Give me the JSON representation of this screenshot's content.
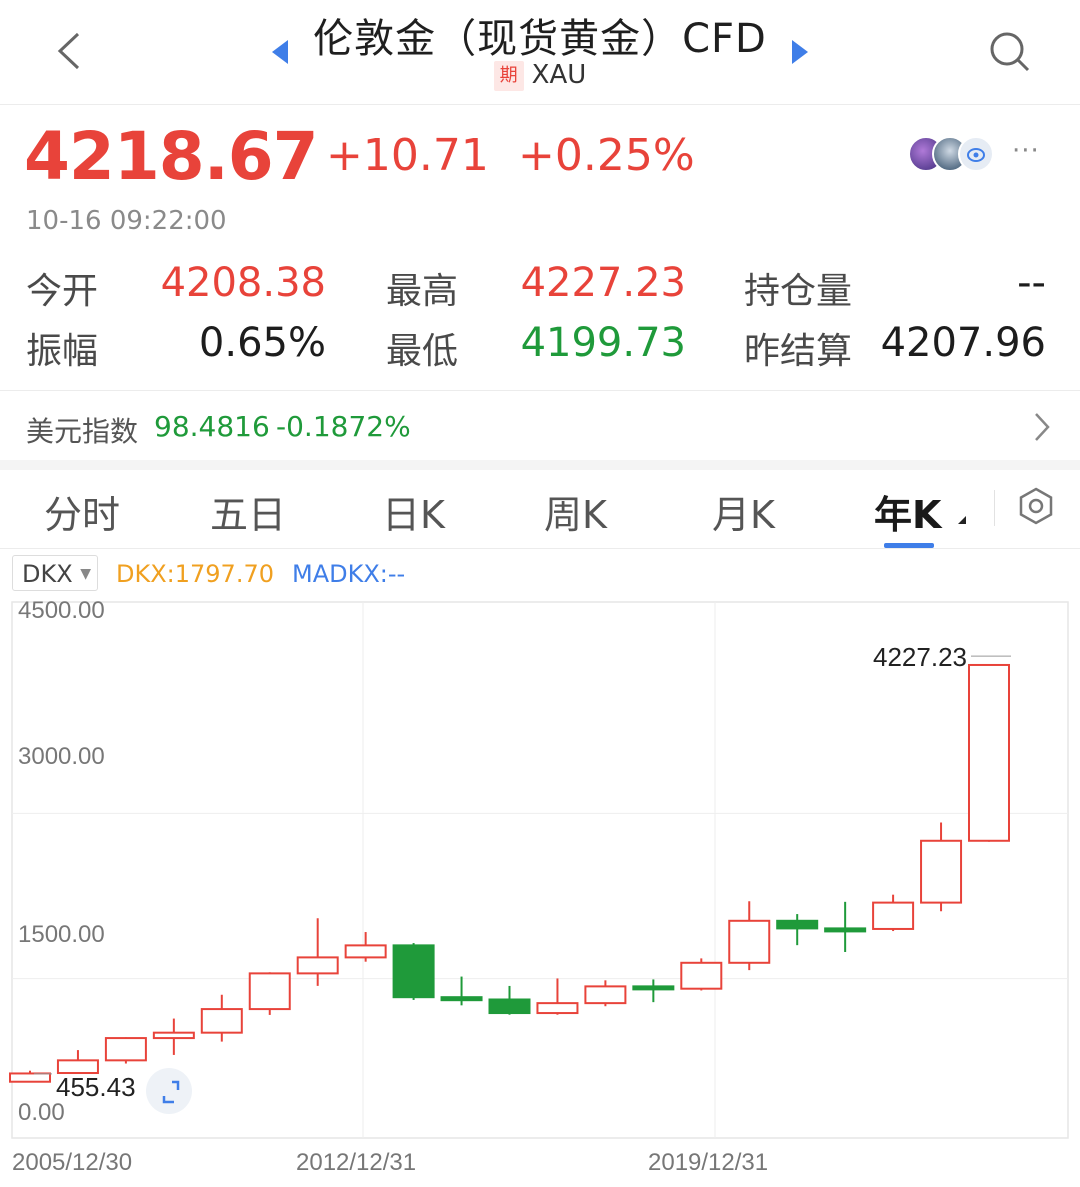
{
  "header": {
    "title": "伦敦金（现货黄金）CFD",
    "badge": "期",
    "symbol": "XAU"
  },
  "quote": {
    "price": "4218.67",
    "change": "+10.71",
    "change_pct": "+0.25%",
    "timestamp": "10-16 09:22:00",
    "more": "···"
  },
  "stats": {
    "open_label": "今开",
    "open": "4208.38",
    "high_label": "最高",
    "high": "4227.23",
    "oi_label": "持仓量",
    "oi": "--",
    "amp_label": "振幅",
    "amp": "0.65%",
    "low_label": "最低",
    "low": "4199.73",
    "prev_label": "昨结算",
    "prev": "4207.96"
  },
  "usd_index": {
    "label": "美元指数",
    "value": "98.4816",
    "change": "-0.1872%"
  },
  "tabs": [
    {
      "label": "分时"
    },
    {
      "label": "五日"
    },
    {
      "label": "日K"
    },
    {
      "label": "周K"
    },
    {
      "label": "月K"
    },
    {
      "label": "年K"
    }
  ],
  "indicator": {
    "select": "DKX",
    "dkx": "DKX:1797.70",
    "madkx": "MADKX:--"
  },
  "colors": {
    "up": "#e8433a",
    "down": "#1f9a3a",
    "accent": "#3f7ee8",
    "dkx": "#f0a020"
  },
  "chart_data": {
    "type": "candlestick",
    "ylim": [
      0,
      4500
    ],
    "yticks": [
      "4500.00",
      "3000.00",
      "1500.00",
      "0.00"
    ],
    "xticks": [
      "2005/12/30",
      "2012/12/31",
      "2019/12/31"
    ],
    "max_label": "4227.23",
    "min_label": "455.43",
    "candles": [
      {
        "year": "2005",
        "open": 438,
        "close": 513,
        "high": 538,
        "low": 455
      },
      {
        "year": "2006",
        "open": 517,
        "close": 632,
        "high": 725,
        "low": 525
      },
      {
        "year": "2007",
        "open": 632,
        "close": 834,
        "high": 841,
        "low": 603
      },
      {
        "year": "2008",
        "open": 834,
        "close": 883,
        "high": 1011,
        "low": 681
      },
      {
        "year": "2009",
        "open": 883,
        "close": 1097,
        "high": 1227,
        "low": 802
      },
      {
        "year": "2010",
        "open": 1097,
        "close": 1421,
        "high": 1431,
        "low": 1044
      },
      {
        "year": "2011",
        "open": 1421,
        "close": 1566,
        "high": 1921,
        "low": 1308
      },
      {
        "year": "2012",
        "open": 1566,
        "close": 1675,
        "high": 1796,
        "low": 1527
      },
      {
        "year": "2013",
        "open": 1675,
        "close": 1205,
        "high": 1696,
        "low": 1180
      },
      {
        "year": "2014",
        "open": 1205,
        "close": 1184,
        "high": 1392,
        "low": 1131
      },
      {
        "year": "2015",
        "open": 1184,
        "close": 1061,
        "high": 1307,
        "low": 1046
      },
      {
        "year": "2016",
        "open": 1061,
        "close": 1151,
        "high": 1375,
        "low": 1046
      },
      {
        "year": "2017",
        "open": 1151,
        "close": 1303,
        "high": 1358,
        "low": 1123
      },
      {
        "year": "2018",
        "open": 1303,
        "close": 1282,
        "high": 1366,
        "low": 1160
      },
      {
        "year": "2019",
        "open": 1282,
        "close": 1517,
        "high": 1557,
        "low": 1266
      },
      {
        "year": "2020",
        "open": 1517,
        "close": 1898,
        "high": 2075,
        "low": 1451
      },
      {
        "year": "2021",
        "open": 1898,
        "close": 1829,
        "high": 1959,
        "low": 1677
      },
      {
        "year": "2022",
        "open": 1829,
        "close": 1824,
        "high": 2070,
        "low": 1615
      },
      {
        "year": "2023",
        "open": 1824,
        "close": 2063,
        "high": 2135,
        "low": 1805
      },
      {
        "year": "2024",
        "open": 2063,
        "close": 2624,
        "high": 2790,
        "low": 1985
      },
      {
        "year": "2025",
        "open": 2624,
        "close": 4219,
        "high": 4227,
        "low": 2615
      }
    ]
  }
}
